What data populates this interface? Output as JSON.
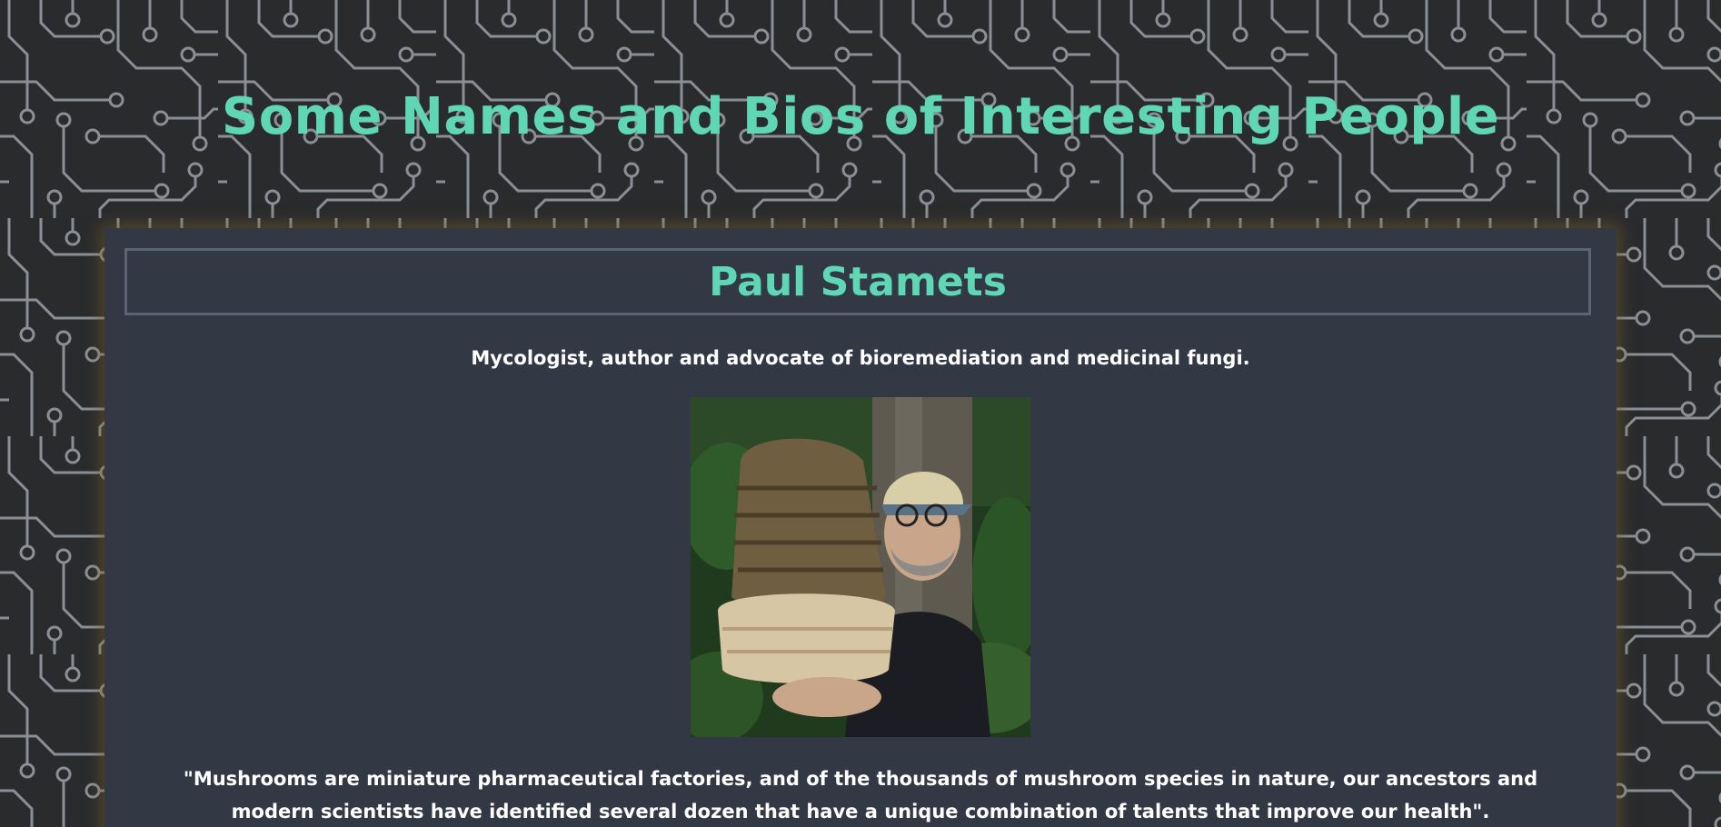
{
  "page": {
    "title": "Some Names and Bios of Interesting People"
  },
  "person": {
    "name": "Paul Stamets",
    "bio": "Mycologist, author and advocate of bioremediation and medicinal fungi.",
    "quote": "\"Mushrooms are miniature pharmaceutical factories, and of the thousands of mushroom species in nature, our ancestors and modern scientists have identified several dozen that have a unique combination of talents that improve our health\".",
    "photo_icon": "portrait-with-giant-mushroom"
  },
  "colors": {
    "accent": "#5fd6b4",
    "background": "#2a2b2d",
    "card": "#323944",
    "circuit_lines": "#8a8f95",
    "text": "#ffffff"
  }
}
